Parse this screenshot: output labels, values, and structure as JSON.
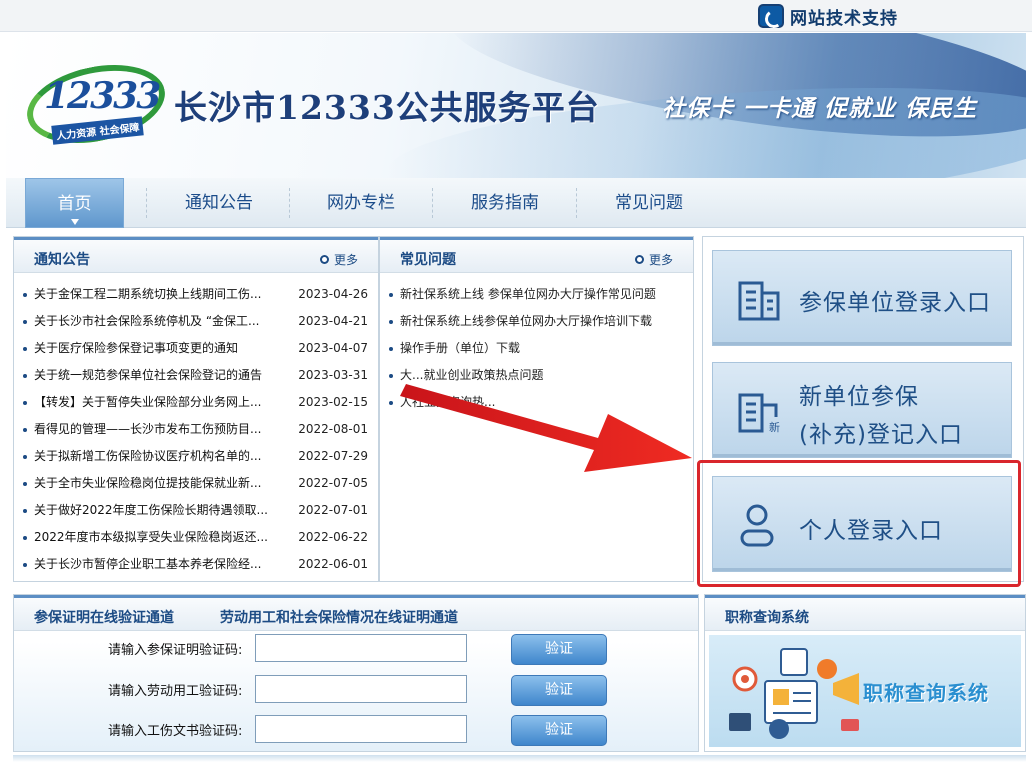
{
  "topbar": {
    "support_label": "网站技术支持",
    "support_icon": "phone-support-icon"
  },
  "banner": {
    "logo_number": "12333",
    "logo_tagline": "人力资源 社会保障",
    "site_title": "长沙市12333公共服务平台",
    "slogan": "社保卡 一卡通 促就业 保民生"
  },
  "nav": {
    "items": [
      {
        "label": "首页",
        "active": true
      },
      {
        "label": "通知公告"
      },
      {
        "label": "网办专栏"
      },
      {
        "label": "服务指南"
      },
      {
        "label": "常见问题"
      }
    ]
  },
  "notices": {
    "title": "通知公告",
    "more_label": "更多",
    "items": [
      {
        "title": "关于金保工程二期系统切换上线期间工伤...",
        "date": "2023-04-26"
      },
      {
        "title": "关于长沙市社会保险系统停机及 “金保工...",
        "date": "2023-04-21"
      },
      {
        "title": "关于医疗保险参保登记事项变更的通知",
        "date": "2023-04-07"
      },
      {
        "title": "关于统一规范参保单位社会保险登记的通告",
        "date": "2023-03-31"
      },
      {
        "title": "【转发】关于暂停失业保险部分业务网上...",
        "date": "2023-02-15"
      },
      {
        "title": "看得见的管理——长沙市发布工伤预防目...",
        "date": "2022-08-01"
      },
      {
        "title": "关于拟新增工伤保险协议医疗机构名单的...",
        "date": "2022-07-29"
      },
      {
        "title": "关于全市失业保险稳岗位提技能保就业新...",
        "date": "2022-07-05"
      },
      {
        "title": "关于做好2022年度工伤保险长期待遇领取...",
        "date": "2022-07-01"
      },
      {
        "title": "2022年度市本级拟享受失业保险稳岗返还...",
        "date": "2022-06-22"
      },
      {
        "title": "关于长沙市暂停企业职工基本养老保险经...",
        "date": "2022-06-01"
      }
    ]
  },
  "faq": {
    "title": "常见问题",
    "more_label": "更多",
    "items": [
      {
        "title": "新社保系统上线 参保单位网办大厅操作常见问题"
      },
      {
        "title": "新社保系统上线参保单位网办大厅操作培训下载"
      },
      {
        "title": "操作手册（单位）下载"
      },
      {
        "title": "大...就业创业政策热点问题"
      },
      {
        "title": "人社业务咨询热..."
      }
    ]
  },
  "login": {
    "unit_label": "参保单位登录入口",
    "new_unit_line1": "新单位参保",
    "new_unit_line2": "(补充)登记入口",
    "new_badge": "新",
    "personal_label": "个人登录入口",
    "highlight_color": "#d9262c"
  },
  "verify": {
    "tab1": "参保证明在线验证通道",
    "tab2": "劳动用工和社会保险情况在线证明通道",
    "fields": [
      {
        "label": "请输入参保证明验证码:",
        "value": "",
        "button": "验证"
      },
      {
        "label": "请输入劳动用工验证码:",
        "value": "",
        "button": "验证"
      },
      {
        "label": "请输入工伤文书验证码:",
        "value": "",
        "button": "验证"
      }
    ]
  },
  "title_query": {
    "title": "职称查询系统",
    "banner_text": "职称查询系统"
  },
  "colors": {
    "brand": "#1c4b84",
    "accent": "#5c8ec4",
    "arrow": "#e0171c"
  }
}
